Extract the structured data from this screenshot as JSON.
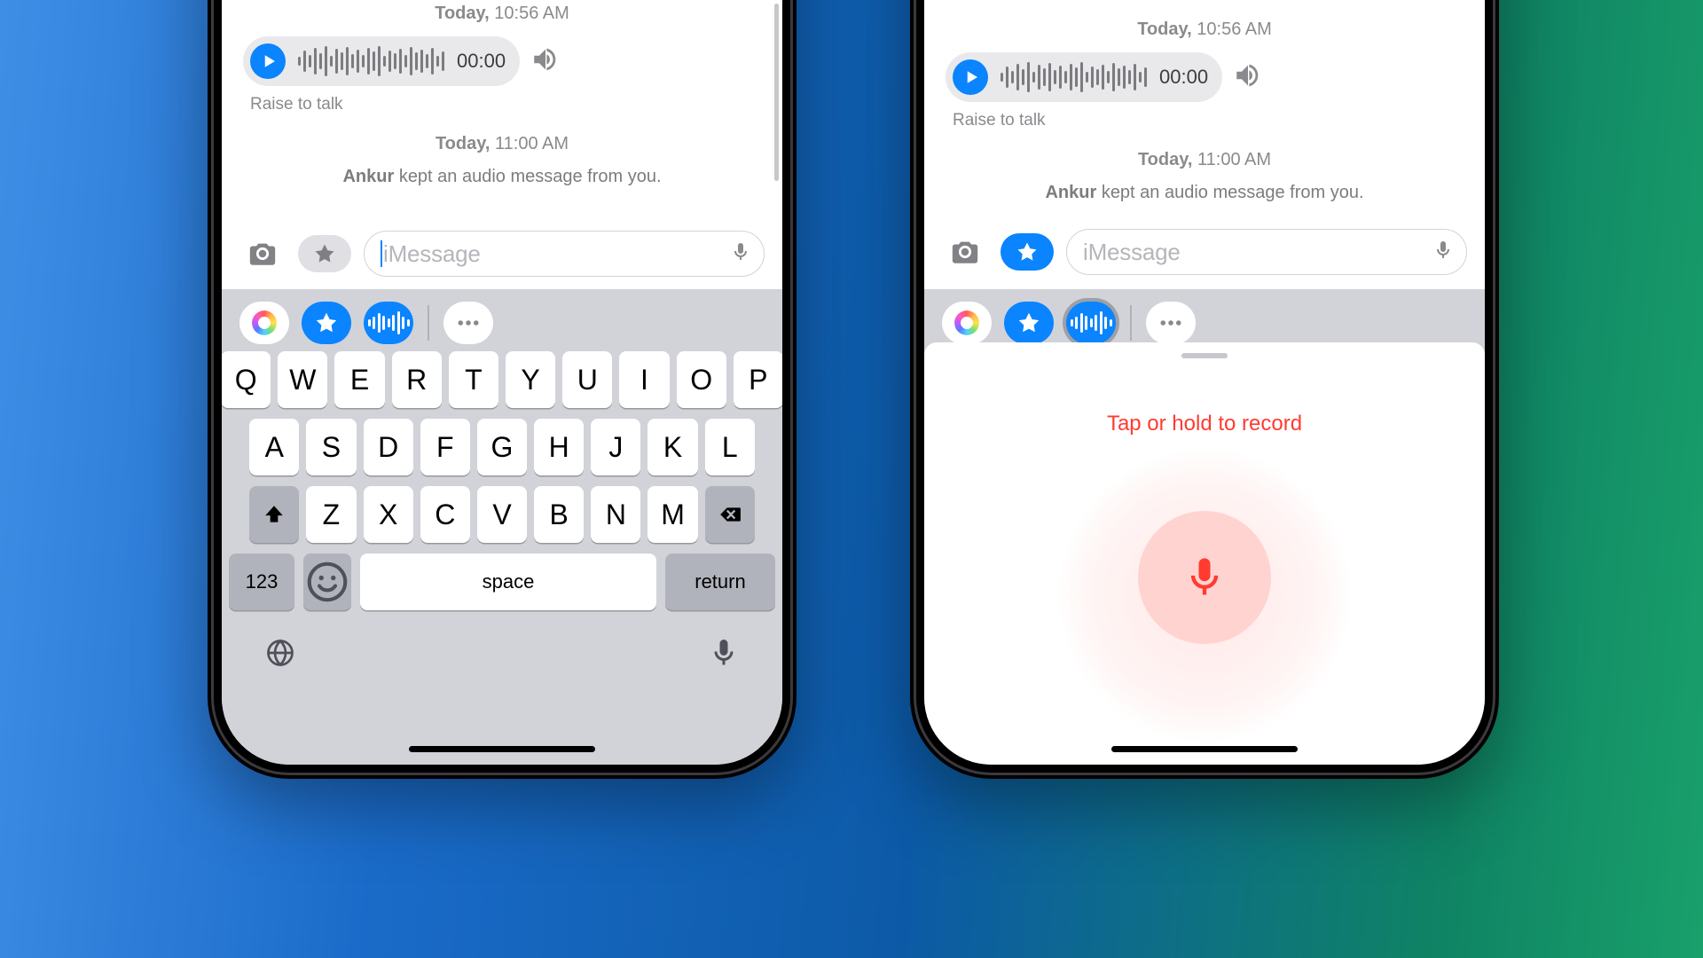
{
  "timestamps": {
    "first": {
      "label": "Today,",
      "time": "10:56 AM"
    },
    "second": {
      "label": "Today,",
      "time": "11:00 AM"
    }
  },
  "audio": {
    "duration": "00:00",
    "raise_label": "Raise to talk"
  },
  "status": {
    "name": "Ankur",
    "rest": "kept an audio message from you."
  },
  "compose": {
    "placeholder": "iMessage"
  },
  "keyboard": {
    "row1": [
      "Q",
      "W",
      "E",
      "R",
      "T",
      "Y",
      "U",
      "I",
      "O",
      "P"
    ],
    "row2": [
      "A",
      "S",
      "D",
      "F",
      "G",
      "H",
      "J",
      "K",
      "L"
    ],
    "row3": [
      "Z",
      "X",
      "C",
      "V",
      "B",
      "N",
      "M"
    ],
    "num_label": "123",
    "space_label": "space",
    "return_label": "return"
  },
  "record": {
    "hint": "Tap or hold to record"
  }
}
